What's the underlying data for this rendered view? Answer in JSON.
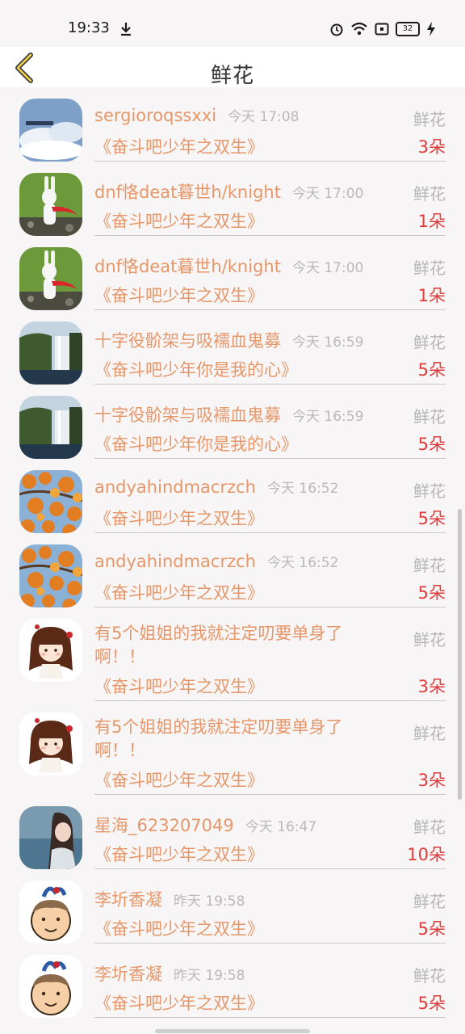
{
  "status": {
    "time": "19:33",
    "battery": "32"
  },
  "title": "鲜花",
  "rows": [
    {
      "nick": "sergioroqssxxi",
      "time": "今天 17:08",
      "book": "《奋斗吧少年之双生》",
      "label": "鲜花",
      "count": "3朵",
      "avatar": "sky"
    },
    {
      "nick": "dnf恪deat暮世h/knight",
      "time": "今天 17:00",
      "book": "《奋斗吧少年之双生》",
      "label": "鲜花",
      "count": "1朵",
      "avatar": "rabbit"
    },
    {
      "nick": "dnf恪deat暮世h/knight",
      "time": "今天 17:00",
      "book": "《奋斗吧少年之双生》",
      "label": "鲜花",
      "count": "1朵",
      "avatar": "rabbit"
    },
    {
      "nick": "十字役骱架与吸襦血鬼募",
      "time": "今天 16:59",
      "book": "《奋斗吧少年你是我的心》",
      "label": "鲜花",
      "count": "5朵",
      "avatar": "waterfall"
    },
    {
      "nick": "十字役骱架与吸襦血鬼募",
      "time": "今天 16:59",
      "book": "《奋斗吧少年你是我的心》",
      "label": "鲜花",
      "count": "5朵",
      "avatar": "waterfall"
    },
    {
      "nick": "andyahindmacrzch",
      "time": "今天 16:52",
      "book": "《奋斗吧少年之双生》",
      "label": "鲜花",
      "count": "5朵",
      "avatar": "maple"
    },
    {
      "nick": "andyahindmacrzch",
      "time": "今天 16:52",
      "book": "《奋斗吧少年之双生》",
      "label": "鲜花",
      "count": "5朵",
      "avatar": "maple"
    },
    {
      "nick": "有5个姐姐的我就注定叨要单身了啊！！",
      "time": "",
      "book": "《奋斗吧少年之双生》",
      "label": "鲜花",
      "count": "3朵",
      "avatar": "girl",
      "tall": true
    },
    {
      "nick": "有5个姐姐的我就注定叨要单身了啊！！",
      "time": "",
      "book": "《奋斗吧少年之双生》",
      "label": "鲜花",
      "count": "3朵",
      "avatar": "girl",
      "tall": true
    },
    {
      "nick": "星海_623207049",
      "time": "今天 16:47",
      "book": "《奋斗吧少年之双生》",
      "label": "鲜花",
      "count": "10朵",
      "avatar": "photo"
    },
    {
      "nick": "李圻香凝",
      "time": "昨天 19:58",
      "book": "《奋斗吧少年之双生》",
      "label": "鲜花",
      "count": "5朵",
      "avatar": "cartoon"
    },
    {
      "nick": "李圻香凝",
      "time": "昨天 19:58",
      "book": "《奋斗吧少年之双生》",
      "label": "鲜花",
      "count": "5朵",
      "avatar": "cartoon"
    }
  ]
}
